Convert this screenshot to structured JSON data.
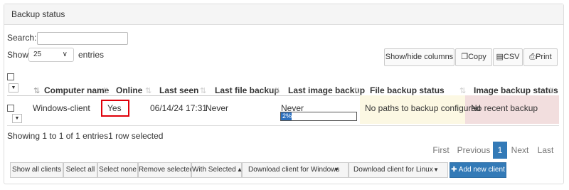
{
  "panel": {
    "title": "Backup status"
  },
  "search": {
    "label": "Search:",
    "value": ""
  },
  "length": {
    "show_label": "Show",
    "selected": "25",
    "entries_label": "entries"
  },
  "toolbar": {
    "show_hide_columns": "Show/hide columns",
    "copy": "Copy",
    "csv": "CSV",
    "print": "Print"
  },
  "table": {
    "headers": [
      "Computer name",
      "Online",
      "Last seen",
      "Last file backup",
      "Last image backup",
      "File backup status",
      "Image backup status"
    ],
    "rows": [
      {
        "computer_name": "Windows-client",
        "online": "Yes",
        "last_seen": "06/14/24 17:31",
        "last_file_backup": "Never",
        "last_image_backup": "Never",
        "image_progress_label": "2%",
        "image_progress_value": 2,
        "file_backup_status": "No paths to backup configured",
        "image_backup_status": "No recent backup"
      }
    ]
  },
  "info": {
    "text": "Showing 1 to 1 of 1 entries1 row selected"
  },
  "pagination": {
    "first": "First",
    "previous": "Previous",
    "current": "1",
    "next": "Next",
    "last": "Last"
  },
  "bottom": {
    "show_all_clients": "Show all clients",
    "select_all": "Select all",
    "select_none": "Select none",
    "remove_selected": "Remove selected",
    "with_selected": "With Selected ▴",
    "download_windows": "Download client for Windows",
    "download_linux": "Download client for Linux",
    "add_new_client": "Add new client"
  },
  "colors": {
    "accent": "#337ab7",
    "online_outline": "#e0000a",
    "file_status_bg": "#fcf8e3",
    "image_status_bg": "#f2dede"
  }
}
